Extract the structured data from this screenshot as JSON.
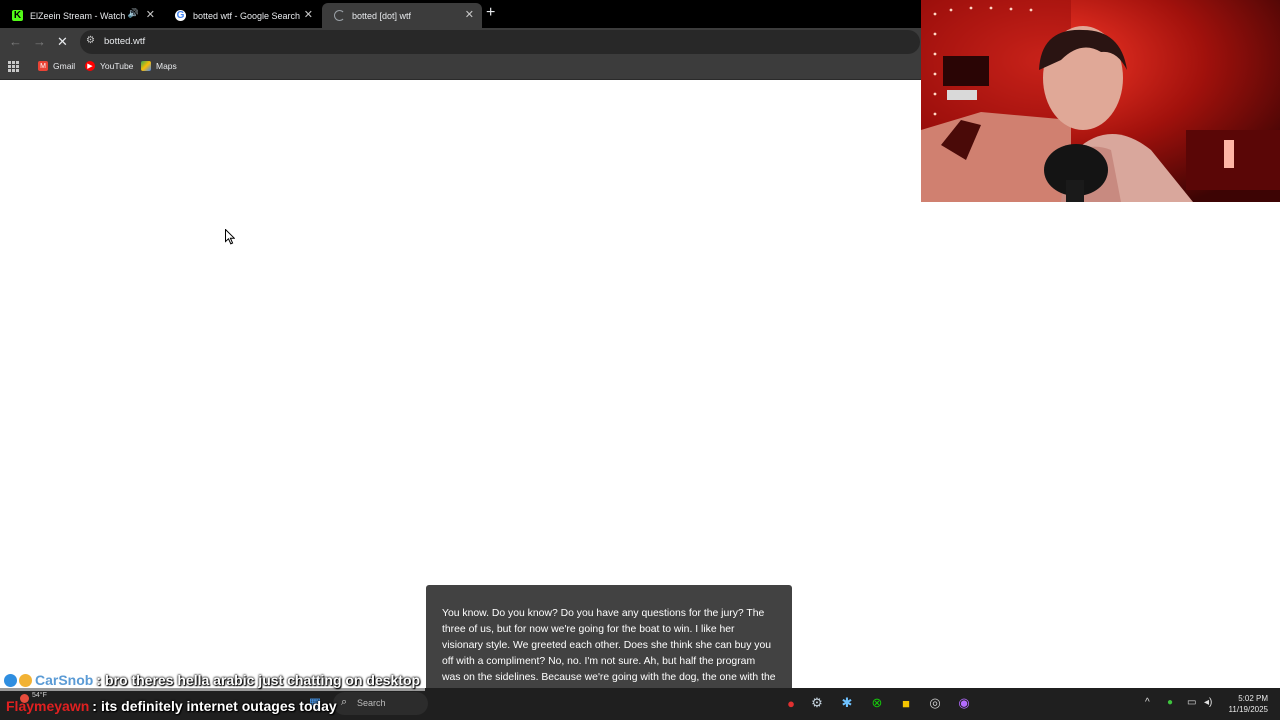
{
  "browser": {
    "tabs": [
      {
        "title": "ElZeein Stream - Watch Live",
        "favicon": "kick-icon",
        "audio": true
      },
      {
        "title": "botted wtf - Google Search",
        "favicon": "google-icon"
      },
      {
        "title": "botted [dot] wtf",
        "favicon": "loading-globe-icon",
        "active": true
      }
    ],
    "url": "botted.wtf",
    "bookmarks": [
      "Gmail",
      "YouTube",
      "Maps"
    ]
  },
  "captions": {
    "text": "You know. Do you know? Do you have any questions for the jury? The three of us, but for now we're going for the boat to win. I like her visionary style. We greeted each other. Does she think she can buy you off with a compliment? No, no. I'm not sure. Ah, but half the program was on the sidelines. Because we're going with the dog, the one with the \"okay\" voice. And over here, everything's in order, you know? Do you have any questions about this? Yes, I have some idea."
  },
  "chat": [
    {
      "username": "CarSnob",
      "separator": ":",
      "message": "bro theres hella arabic just chatting on desktop",
      "color": "#5b9bd5"
    },
    {
      "username": "Flaymeyawn",
      "separator": ":",
      "message": "its definitely internet outages today",
      "color": "#e02020"
    }
  ],
  "taskbar": {
    "weather": "54°F",
    "search_placeholder": "Search",
    "time": "5:02 PM",
    "date": "11/19/2025"
  }
}
